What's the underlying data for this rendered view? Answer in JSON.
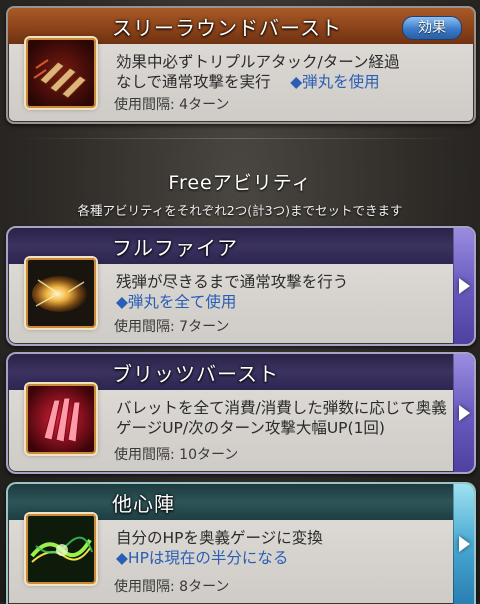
{
  "support_ability": {
    "name": "スリーラウンドバースト",
    "effect_button": "効果",
    "desc_lines": [
      "効果中必ずトリプルアタック/ターン経過",
      "なしで通常攻撃を実行"
    ],
    "desc_highlight": "◆弾丸を使用",
    "cooldown": "使用間隔: 4ターン"
  },
  "section": {
    "title": "Freeアビリティ",
    "subtitle": "各種アビリティをそれぞれ2つ(計3つ)までセットできます"
  },
  "abilities": [
    {
      "name": "フルファイア",
      "desc_lines": [
        "残弾が尽きるまで通常攻撃を行う"
      ],
      "desc_highlight": "◆弾丸を全て使用",
      "cooldown": "使用間隔: 7ターン"
    },
    {
      "name": "ブリッツバースト",
      "desc_lines": [
        "バレットを全て消費/消費した弾数に応じて奥義",
        "ゲージUP/次のターン攻撃大幅UP(1回)"
      ],
      "desc_highlight": "",
      "cooldown": "使用間隔: 10ターン"
    },
    {
      "name": "他心陣",
      "desc_lines": [
        "自分のHPを奥義ゲージに変換"
      ],
      "desc_highlight": "◆HPは現在の半分になる",
      "cooldown": "使用間隔: 8ターン"
    }
  ],
  "colors": {
    "orange_header": "#8a4119",
    "purple_header": "#3b3260",
    "teal_header": "#2d5559",
    "highlight_text": "#2a5fb5"
  },
  "icons": [
    "bullets-icon",
    "muzzle-flash-icon",
    "red-bullets-icon",
    "green-energy-icon",
    "arrow-right-icon"
  ]
}
